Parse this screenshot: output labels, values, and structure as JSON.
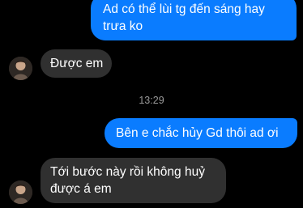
{
  "messages": [
    {
      "direction": "outgoing",
      "text": "Ad có thể lùi tg đến sáng hay trưa ko"
    },
    {
      "direction": "incoming",
      "text": "Được em"
    },
    {
      "direction": "outgoing",
      "text": "Bên e chắc hủy Gd thôi ad ơi"
    },
    {
      "direction": "incoming",
      "text": "Tới bước này rồi không huỷ được á em"
    }
  ],
  "timestamp": "13:29",
  "colors": {
    "background": "#000000",
    "outgoing_bubble": "#0a7cff",
    "incoming_bubble": "#303030",
    "timestamp_text": "#9a9a9a"
  }
}
